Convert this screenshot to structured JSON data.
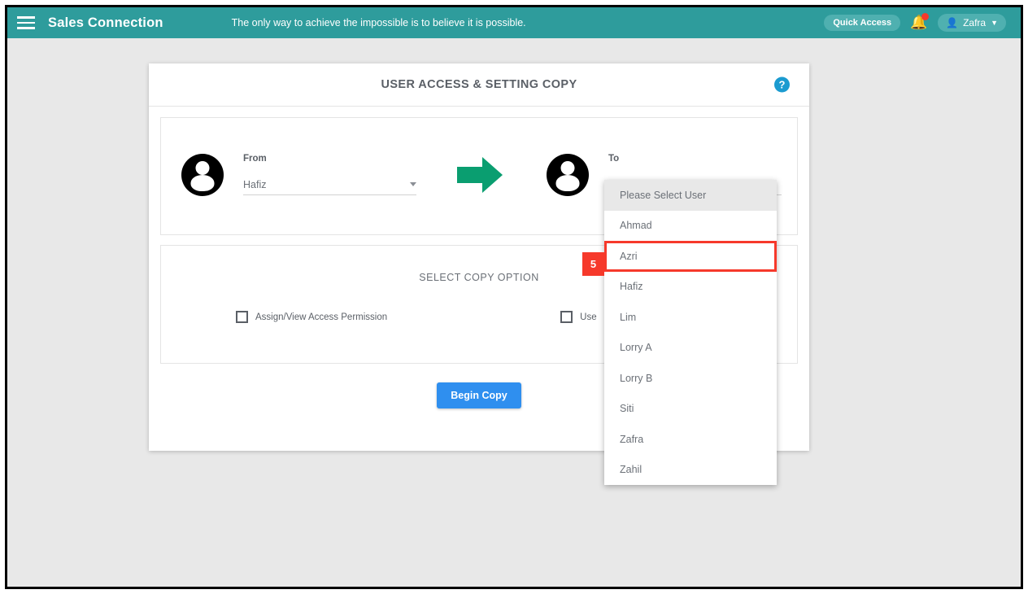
{
  "topbar": {
    "menu_icon": "hamburger-icon",
    "brand": "Sales Connection",
    "tagline": "The only way to achieve the impossible is to believe it is possible.",
    "quick_access_label": "Quick Access",
    "bell_icon": "bell-icon",
    "has_notification": true,
    "user_name": "Zafra",
    "teal": "#2e9c9c"
  },
  "card": {
    "title": "USER ACCESS & SETTING COPY",
    "help_icon": "question-mark-icon",
    "help_color": "#1b9bd0"
  },
  "users": {
    "from": {
      "label": "From",
      "value": "Hafiz"
    },
    "to": {
      "label": "To",
      "value": ""
    },
    "arrow_icon": "arrow-right-icon",
    "arrow_color": "#0a9e70"
  },
  "dropdown": {
    "open": true,
    "items": [
      {
        "label": "Please Select User",
        "state": "highlighted"
      },
      {
        "label": "Ahmad",
        "state": "normal"
      },
      {
        "label": "Azri",
        "state": "outlined"
      },
      {
        "label": "Hafiz",
        "state": "normal"
      },
      {
        "label": "Lim",
        "state": "normal"
      },
      {
        "label": "Lorry A",
        "state": "normal"
      },
      {
        "label": "Lorry B",
        "state": "normal"
      },
      {
        "label": "Siti",
        "state": "normal"
      },
      {
        "label": "Zafra",
        "state": "normal"
      },
      {
        "label": "Zahil",
        "state": "normal"
      }
    ]
  },
  "annotation": {
    "step_number": "5",
    "color": "#f6392b"
  },
  "copy_options": {
    "title": "SELECT COPY OPTION",
    "checkboxes": [
      {
        "label": "Assign/View Access Permission",
        "checked": false
      },
      {
        "label": "Use",
        "checked": false
      }
    ],
    "begin_button": "Begin Copy",
    "button_color": "#2f8fef"
  }
}
